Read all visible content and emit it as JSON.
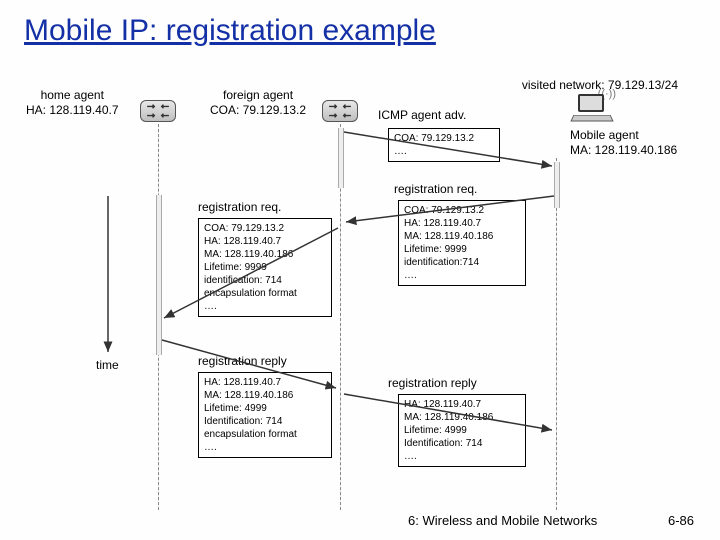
{
  "title": "Mobile IP: registration example",
  "visited_network": "visited network: 79.129.13/24",
  "home_agent": {
    "label": "home agent",
    "addr": "HA: 128.119.40.7"
  },
  "foreign_agent": {
    "label": "foreign agent",
    "addr": "COA: 79.129.13.2"
  },
  "mobile_agent": {
    "label": "Mobile agent",
    "addr": "MA: 128.119.40.186"
  },
  "icmp_label": "ICMP agent adv.",
  "icmp_box": [
    "COA: 79.129.13.2",
    "…."
  ],
  "time_label": "time",
  "reg_req_label": "registration req.",
  "reg_req_box_right": [
    "COA: 79.129.13.2",
    "HA: 128.119.40.7",
    "MA: 128.119.40.186",
    "Lifetime: 9999",
    "identification:714",
    "…."
  ],
  "reg_req_box_left": [
    "COA: 79.129.13.2",
    "HA: 128.119.40.7",
    "MA: 128.119.40.186",
    "Lifetime: 9999",
    "identification: 714",
    "encapsulation format",
    "…."
  ],
  "reg_reply_label": "registration reply",
  "reg_reply_box_left": [
    "HA: 128.119.40.7",
    "MA: 128.119.40.186",
    "Lifetime: 4999",
    "Identification: 714",
    "encapsulation format",
    "…."
  ],
  "reg_reply_box_right": [
    "HA: 128.119.40.7",
    "MA: 128.119.40.186",
    "Lifetime: 4999",
    "Identification: 714",
    "…."
  ],
  "footer_text": "6: Wireless and Mobile Networks",
  "page_number": "6-86"
}
